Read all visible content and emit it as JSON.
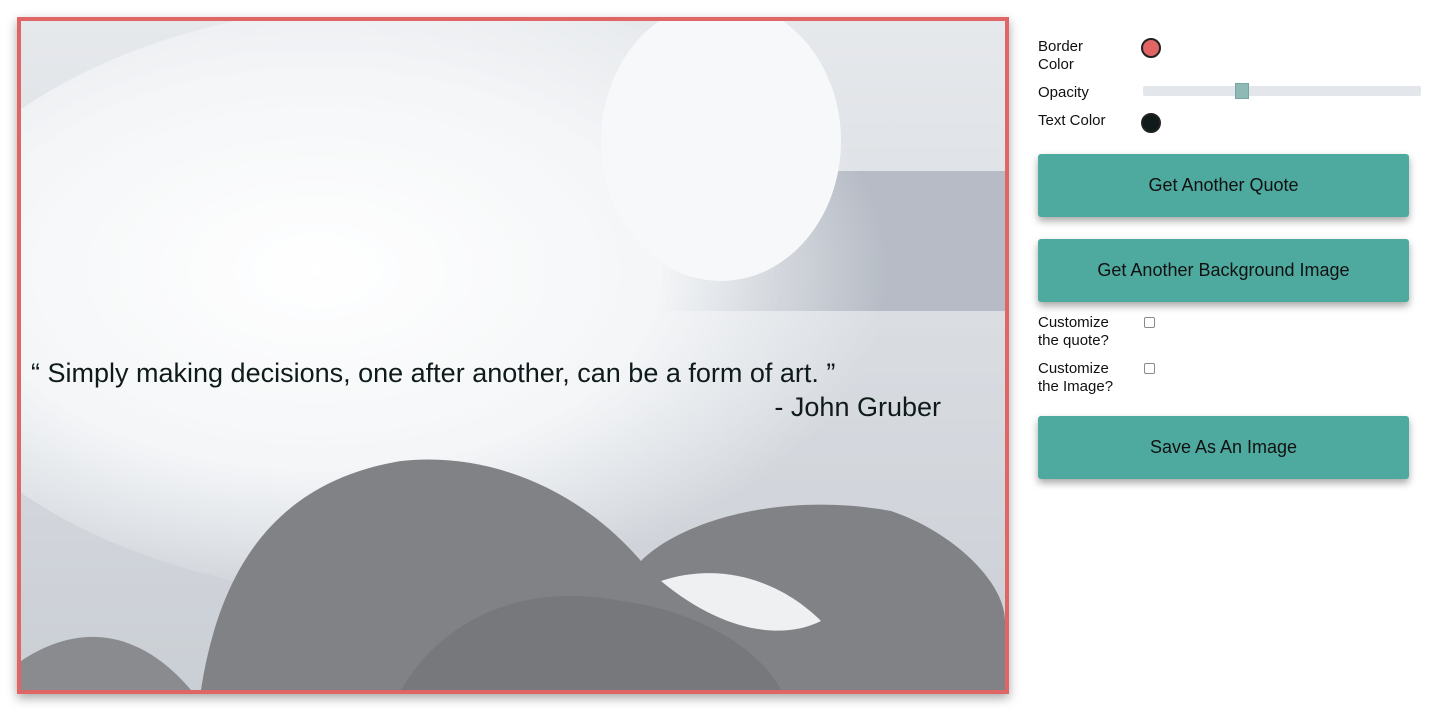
{
  "quote": {
    "text": "“ Simply making decisions, one after another, can be a form of art. ”",
    "author": "- John Gruber",
    "border_color": "#e06666",
    "text_color": "#0f1a1a",
    "opacity": 0.35
  },
  "controls": {
    "border_color_label_line1": "Border",
    "border_color_label_line2": "Color",
    "opacity_label": "Opacity",
    "text_color_label": "Text Color",
    "get_quote_label": "Get Another Quote",
    "get_image_label": "Get Another Background Image",
    "customize_quote_line1": "Customize",
    "customize_quote_line2": "the quote?",
    "customize_image_line1": "Customize",
    "customize_image_line2": "the Image?",
    "customize_quote_checked": false,
    "customize_image_checked": false,
    "save_label": "Save As An Image",
    "button_color": "#4eaa9f"
  }
}
